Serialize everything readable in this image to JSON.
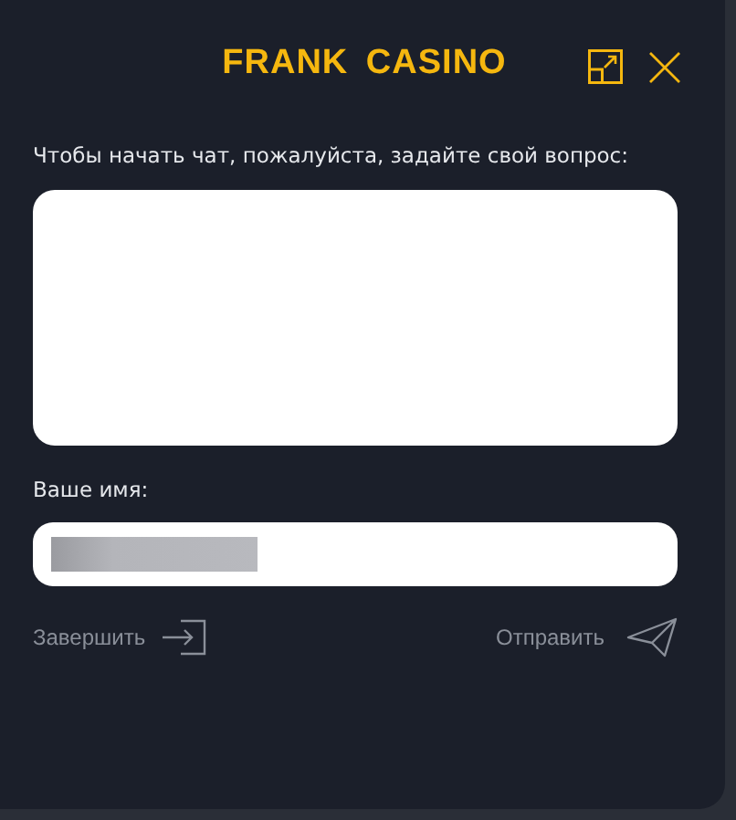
{
  "header": {
    "logo": "FRANK CASINO"
  },
  "prompt": "Чтобы начать чат, пожалуйста, задайте свой вопрос:",
  "name_label": "Ваше имя:",
  "name_field": {
    "redacted": true
  },
  "actions": [
    {
      "kind": "finish",
      "label": "Завершить"
    },
    {
      "kind": "send",
      "label": "Отправить"
    }
  ]
}
